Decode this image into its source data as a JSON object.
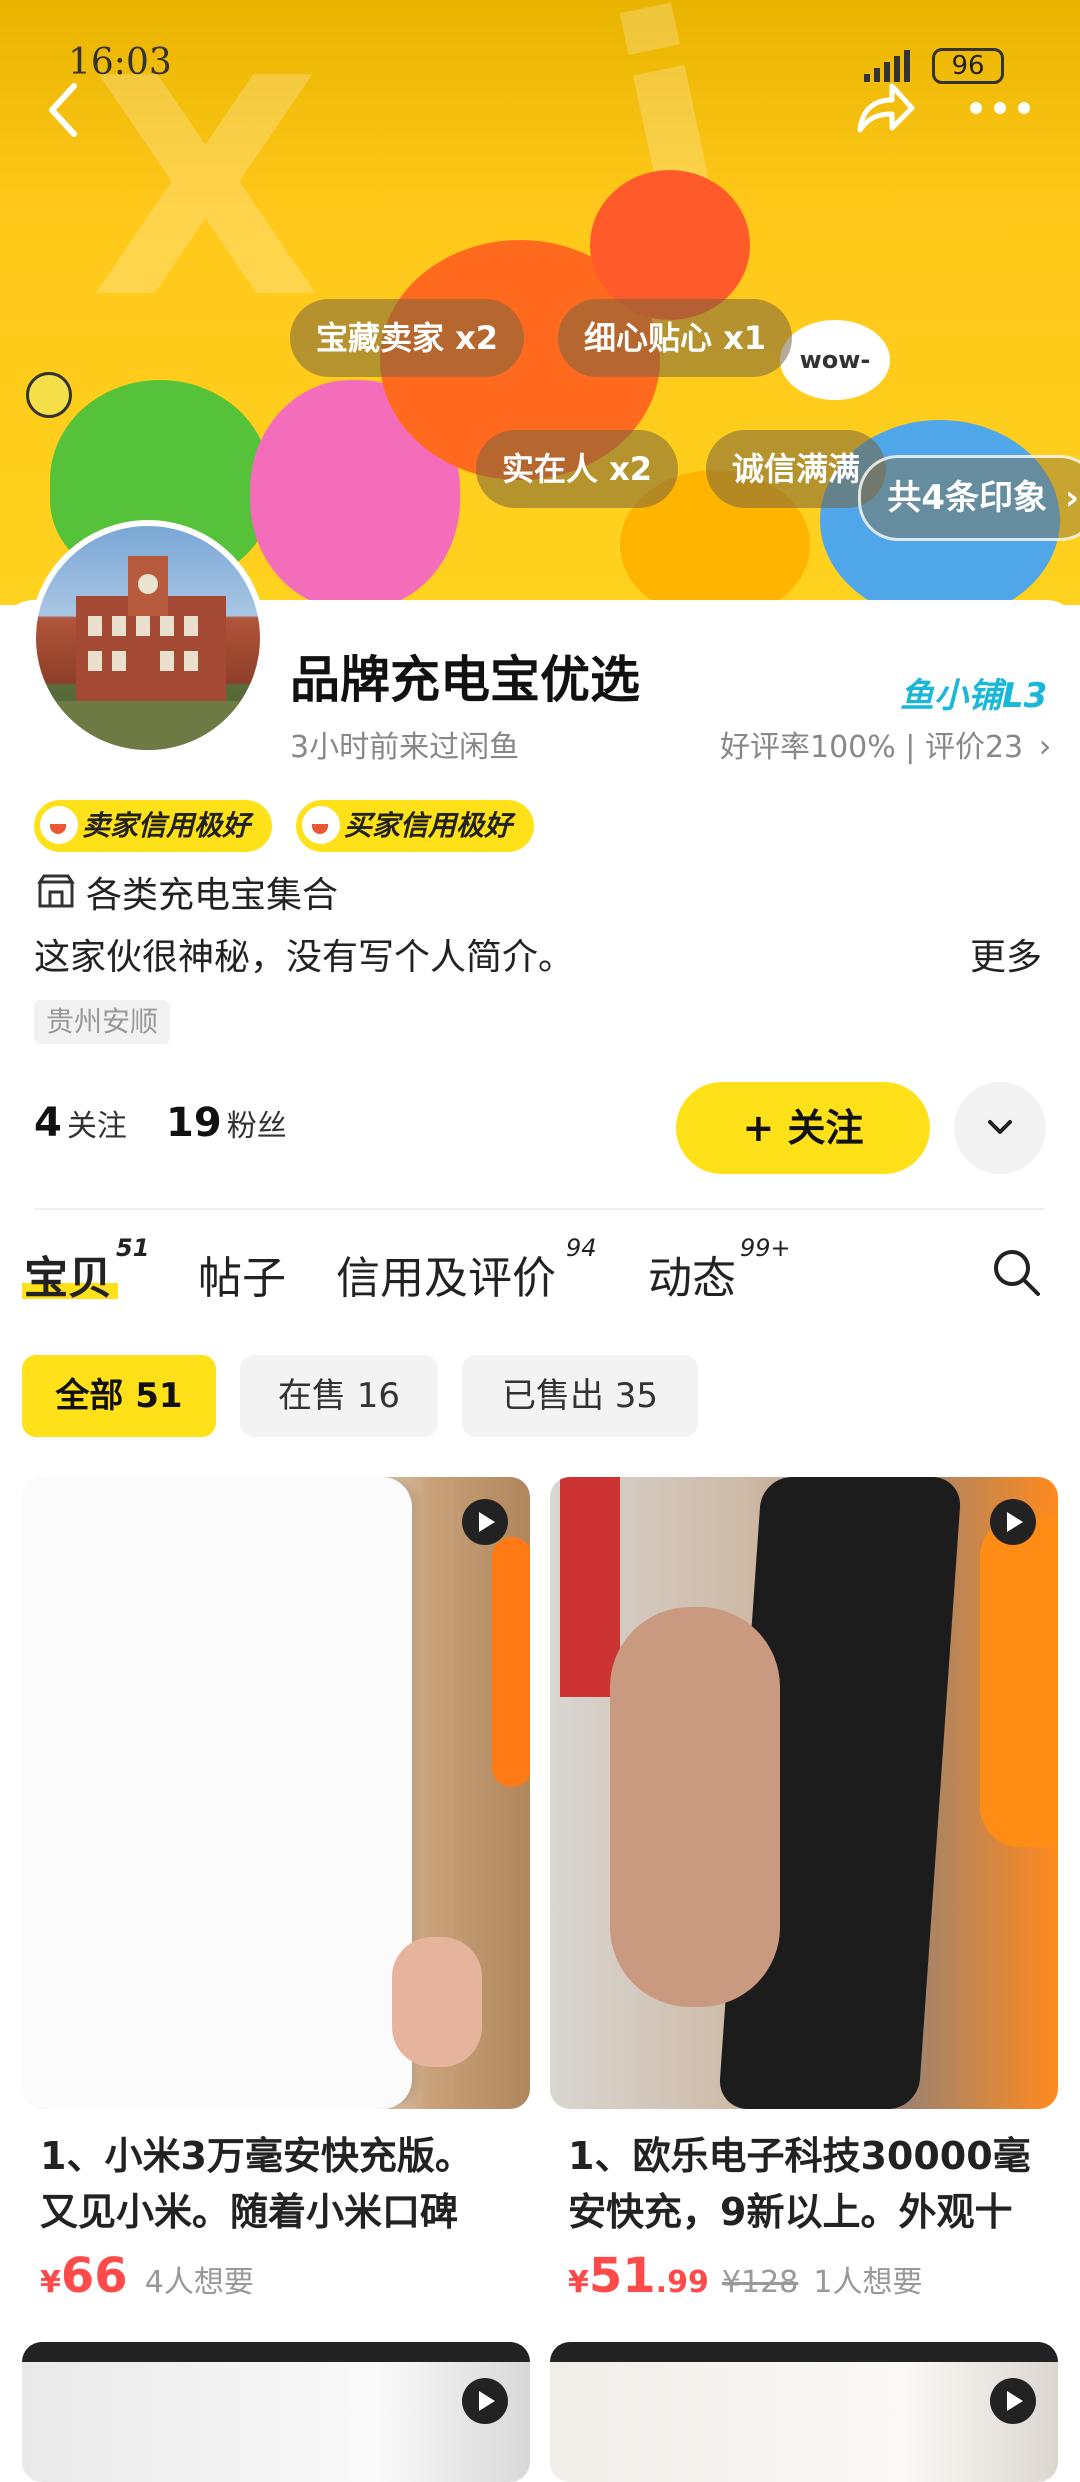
{
  "status_bar": {
    "time": "16:03",
    "battery": "96"
  },
  "banner": {
    "tags": [
      "宝藏卖家 x2",
      "细心贴心 x1",
      "实在人 x2",
      "诚信满满"
    ],
    "impression_btn": "共4条印象"
  },
  "profile": {
    "name": "品牌充电宝优选",
    "last_seen": "3小时前来过闲鱼",
    "shop_level": "鱼小铺L3",
    "rating_summary": "好评率100% | 评价23",
    "badges": [
      "卖家信用极好",
      "买家信用极好"
    ],
    "shop_category": "各类充电宝集合",
    "bio": "这家伙很神秘，没有写个人简介。",
    "bio_more": "更多",
    "location": "贵州安顺",
    "following_count": "4",
    "following_label": "关注",
    "followers_count": "19",
    "followers_label": "粉丝",
    "follow_button": "+ 关注"
  },
  "tabs": [
    {
      "label": "宝贝",
      "count": "51"
    },
    {
      "label": "帖子",
      "count": ""
    },
    {
      "label": "信用及评价",
      "count": "94"
    },
    {
      "label": "动态",
      "count": "99+"
    }
  ],
  "filters": [
    "全部 51",
    "在售 16",
    "已售出 35"
  ],
  "products": [
    {
      "title_line1": "1、小米3万毫安快充版。",
      "title_line2": "又见小米。随着小米口碑",
      "price_symbol": "¥",
      "price_int": "66",
      "price_dec": "",
      "orig_price": "",
      "wants": "4人想要"
    },
    {
      "title_line1": "1、欧乐电子科技30000毫",
      "title_line2": "安快充，9新以上。外观十",
      "price_symbol": "¥",
      "price_int": "51",
      "price_dec": ".99",
      "orig_price": "¥128",
      "wants": "1人想要"
    }
  ],
  "colors": {
    "accent_yellow": "#ffe11a",
    "price_red": "#ff4a4a",
    "level_blue": "#1ab7d8"
  }
}
